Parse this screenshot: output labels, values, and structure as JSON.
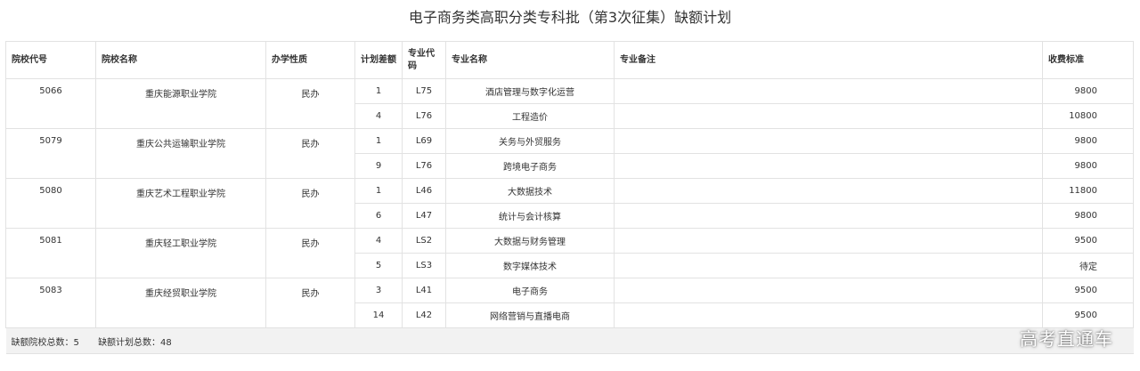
{
  "title": "电子商务类高职分类专科批（第3次征集）缺额计划",
  "headers": {
    "school_code": "院校代号",
    "school_name": "院校名称",
    "ownership": "办学性质",
    "plan_gap": "计划差额",
    "major_code": "专业代码",
    "major_name": "专业名称",
    "major_note": "专业备注",
    "fee": "收费标准"
  },
  "schools": [
    {
      "code": "5066",
      "name": "重庆能源职业学院",
      "ownership": "民办",
      "majors": [
        {
          "gap": "1",
          "code": "L75",
          "name": "酒店管理与数字化运营",
          "note": "",
          "fee": "9800"
        },
        {
          "gap": "4",
          "code": "L76",
          "name": "工程造价",
          "note": "",
          "fee": "10800"
        }
      ]
    },
    {
      "code": "5079",
      "name": "重庆公共运输职业学院",
      "ownership": "民办",
      "majors": [
        {
          "gap": "1",
          "code": "L69",
          "name": "关务与外贸服务",
          "note": "",
          "fee": "9800"
        },
        {
          "gap": "9",
          "code": "L76",
          "name": "跨境电子商务",
          "note": "",
          "fee": "9800"
        }
      ]
    },
    {
      "code": "5080",
      "name": "重庆艺术工程职业学院",
      "ownership": "民办",
      "majors": [
        {
          "gap": "1",
          "code": "L46",
          "name": "大数据技术",
          "note": "",
          "fee": "11800"
        },
        {
          "gap": "6",
          "code": "L47",
          "name": "统计与会计核算",
          "note": "",
          "fee": "9800"
        }
      ]
    },
    {
      "code": "5081",
      "name": "重庆轻工职业学院",
      "ownership": "民办",
      "majors": [
        {
          "gap": "4",
          "code": "LS2",
          "name": "大数据与财务管理",
          "note": "",
          "fee": "9500"
        },
        {
          "gap": "5",
          "code": "LS3",
          "name": "数字媒体技术",
          "note": "",
          "fee": "待定"
        }
      ]
    },
    {
      "code": "5083",
      "name": "重庆经贸职业学院",
      "ownership": "民办",
      "majors": [
        {
          "gap": "3",
          "code": "L41",
          "name": "电子商务",
          "note": "",
          "fee": "9500"
        },
        {
          "gap": "14",
          "code": "L42",
          "name": "网络营销与直播电商",
          "note": "",
          "fee": "9500"
        }
      ]
    }
  ],
  "footer": {
    "school_total": "缺额院校总数：5",
    "plan_total": "缺额计划总数：48"
  },
  "watermark": "高考直通车"
}
